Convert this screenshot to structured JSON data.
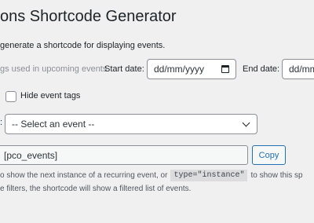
{
  "header": {
    "title": "ons Shortcode Generator",
    "description": "generate a shortcode for displaying events."
  },
  "filters": {
    "tags_text": "gs used in upcoming events",
    "start_label": "Start date:",
    "start_value": "dd/mm/yyyy",
    "end_label": "End date:",
    "end_value": "dd/mm"
  },
  "options": {
    "hide_tags_label": "Hide event tags",
    "hide_tags_checked": false
  },
  "event_select": {
    "prefix": ":",
    "selected": "-- Select an event --"
  },
  "shortcode": {
    "value": "[pco_events]",
    "copy_label": "Copy"
  },
  "help": {
    "line1_before": "o show the next instance of a recurring event, or",
    "line1_code": "type=\"instance\"",
    "line1_after": "to show this sp",
    "line2": "e filters, the shortcode will show a filtered list of events."
  }
}
